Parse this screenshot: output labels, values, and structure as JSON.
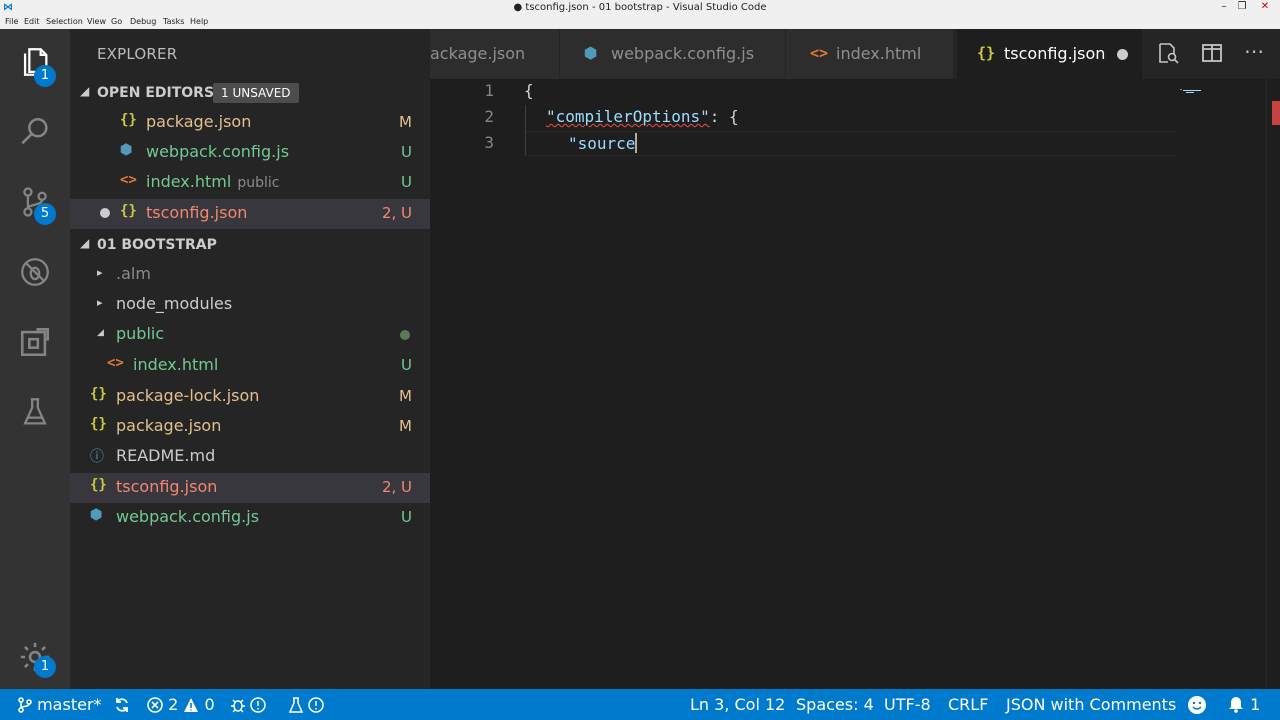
{
  "window": {
    "title": "● tsconfig.json - 01 bootstrap - Visual Studio Code",
    "menu": [
      "File",
      "Edit",
      "Selection",
      "View",
      "Go",
      "Debug",
      "Tasks",
      "Help"
    ]
  },
  "activity_bar": {
    "explorer_badge": "1",
    "scm_badge": "5",
    "settings_badge": "1"
  },
  "sidebar": {
    "title": "EXPLORER",
    "open_editors": {
      "label": "OPEN EDITORS",
      "badge": "1 UNSAVED",
      "items": [
        {
          "name": "package.json",
          "icon": "{}",
          "status": "M"
        },
        {
          "name": "webpack.config.js",
          "icon": "⬢",
          "status": "U"
        },
        {
          "name": "index.html",
          "icon": "<>",
          "sub": "public",
          "status": "U"
        },
        {
          "name": "tsconfig.json",
          "icon": "{}",
          "status": "2, U"
        }
      ]
    },
    "folder": {
      "label": "01 BOOTSTRAP",
      "items": [
        {
          "name": ".alm",
          "caret": "▸"
        },
        {
          "name": "node_modules",
          "caret": "▸"
        },
        {
          "name": "public",
          "caret": "◢"
        },
        {
          "name": "index.html",
          "icon": "<>",
          "status": "U"
        },
        {
          "name": "package-lock.json",
          "icon": "{}",
          "status": "M"
        },
        {
          "name": "package.json",
          "icon": "{}",
          "status": "M"
        },
        {
          "name": "README.md",
          "icon": "ⓘ"
        },
        {
          "name": "tsconfig.json",
          "icon": "{}",
          "status": "2, U"
        },
        {
          "name": "webpack.config.js",
          "icon": "⬢",
          "status": "U"
        }
      ]
    }
  },
  "tabs": [
    {
      "label": "ackage.json",
      "icon": ""
    },
    {
      "label": "webpack.config.js",
      "icon": "⬢"
    },
    {
      "label": "index.html",
      "icon": "<>"
    },
    {
      "label": "tsconfig.json",
      "icon": "{}"
    }
  ],
  "editor": {
    "line_numbers": [
      "1",
      "2",
      "3"
    ],
    "line1": "{",
    "line2_key": "\"compilerOptions\"",
    "line2_rest": ": {",
    "line3": "\"source"
  },
  "statusbar": {
    "branch": "master*",
    "errors": "2",
    "warnings": "0",
    "position": "Ln 3, Col 12",
    "spaces": "Spaces: 4",
    "encoding": "UTF-8",
    "eol": "CRLF",
    "language": "JSON with Comments",
    "notifications": "1"
  },
  "colors": {
    "statusbar": "#007acc",
    "json_icon": "#cbcb41",
    "modified": "#e2c08d",
    "untracked": "#73c991",
    "error": "#f48771"
  }
}
